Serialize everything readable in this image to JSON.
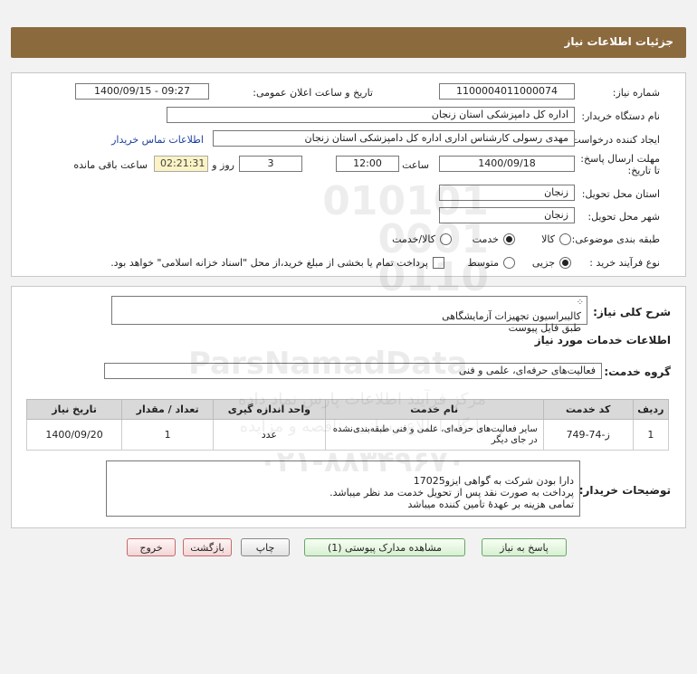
{
  "header": {
    "title": "جزئیات اطلاعات نیاز"
  },
  "form": {
    "need_number_label": "شماره نیاز:",
    "need_number": "1100004011000074",
    "announce_label": "تاریخ و ساعت اعلان عمومی:",
    "announce_value": "1400/09/15 - 09:27",
    "buyer_org_label": "نام دستگاه خریدار:",
    "buyer_org": "اداره کل دامپزشکی استان زنجان",
    "creator_label": "ایجاد کننده درخواست:",
    "creator": "مهدی رسولی کارشناس اداری اداره کل دامپزشکی استان زنجان",
    "contact_link": "اطلاعات تماس خریدار",
    "deadline_label": "مهلت ارسال پاسخ: تا تاریخ:",
    "deadline_date": "1400/09/18",
    "time_label": "ساعت",
    "deadline_time": "12:00",
    "days_value": "3",
    "days_label": "روز و",
    "remaining_time": "02:21:31",
    "remaining_label": "ساعت باقی مانده",
    "province_label": "استان محل تحویل:",
    "province": "زنجان",
    "city_label": "شهر محل تحویل:",
    "city": "زنجان",
    "category_label": "طبقه بندی موضوعی:",
    "category_options": [
      "کالا",
      "خدمت",
      "کالا/خدمت"
    ],
    "category_selected": 1,
    "process_label": "نوع فرآیند خرید :",
    "process_options": [
      "جزیی",
      "متوسط"
    ],
    "process_selected": 0,
    "payment_note": "پرداخت تمام یا بخشی از مبلغ خرید،از محل \"اسناد خزانه اسلامی\" خواهد بود."
  },
  "description": {
    "label": "شرح کلی نیاز:",
    "line1": "کالیبراسیون تجهیزات آزمایشگاهی",
    "line2": "طبق فایل پیوست",
    "services_title": "اطلاعات خدمات مورد نیاز",
    "service_group_label": "گروه خدمت:",
    "service_group": "فعالیت‌های حرفه‌ای، علمی و فنی"
  },
  "table": {
    "headers": [
      "ردیف",
      "کد خدمت",
      "نام خدمت",
      "واحد اندازه گیری",
      "تعداد / مقدار",
      "تاریخ نیاز"
    ],
    "rows": [
      [
        "1",
        "ز-74-749",
        "سایر فعالیت‌های حرفه‌ای، علمی و فنی طبقه‌بندی‌نشده در جای دیگر",
        "عدد",
        "1",
        "1400/09/20"
      ]
    ]
  },
  "buyer_notes": {
    "label": "توضیحات خریدار:",
    "line1": "دارا بودن شرکت به گواهی ایزو17025",
    "line2": "پرداخت به صورت نقد پس از تحویل خدمت مد نظر میباشد.",
    "line3": "تمامی هزینه بر عهدهٔ تامین کننده میباشد"
  },
  "buttons": {
    "reply": "پاسخ به نیاز",
    "attachments": "مشاهده مدارک پیوستی (1)",
    "print": "چاپ",
    "back": "بازگشت",
    "exit": "خروج"
  },
  "watermark": {
    "digits1": "010101",
    "digits2": "0001",
    "digits3": "0110",
    "brand": "ParsNamadData",
    "fa1": "مرکز فرآیند اطلاعات پارس نماد داده",
    "fa2": "پایگاه اطلاع رسانی مناقصه و مزایده",
    "phone": "۰۲۱-۸۸۳۴۹۶۷۰"
  },
  "colors": {
    "header": "#8b6a3e",
    "timer_bg": "#fbf3c4",
    "link": "#1b3f9e"
  }
}
